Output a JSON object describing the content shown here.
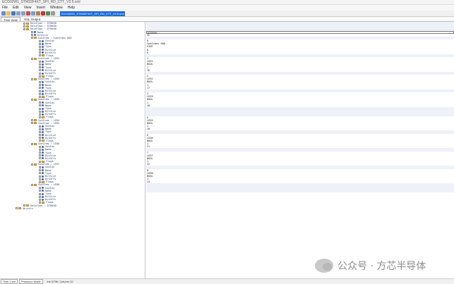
{
  "window": {
    "title": "ECO32W1_STM32F4XT_SPI_RD_CTT_V2.5.xml"
  },
  "menu": [
    "File",
    "Edit",
    "View",
    "Insert",
    "Window",
    "Help"
  ],
  "toolbar": {
    "path_value": "ECO32W1_STM32F4XT_SPI_RD_CTT_V2.5.xml"
  },
  "tabs": [
    {
      "label": "Tree View",
      "active": true
    },
    {
      "label": "XSL Output",
      "active": false
    }
  ],
  "tree_rows": [
    {
      "depth": 3,
      "icon": "folder",
      "text": "DataType : DT0000"
    },
    {
      "depth": 3,
      "icon": "folder",
      "text": "DataType : DT0000"
    },
    {
      "depth": 3,
      "icon": "folder",
      "text": "DataType : DT0000"
    },
    {
      "depth": 4,
      "icon": "dot",
      "text": "Name"
    },
    {
      "depth": 4,
      "icon": "dot",
      "text": "BitSize"
    },
    {
      "depth": 4,
      "icon": "folder",
      "text": "SubItem : SubIndex 000"
    },
    {
      "depth": 5,
      "icon": "dot",
      "text": "SubIdx"
    },
    {
      "depth": 5,
      "icon": "dot",
      "text": "Name"
    },
    {
      "depth": 5,
      "icon": "dot",
      "text": "Type"
    },
    {
      "depth": 5,
      "icon": "dot",
      "text": "BitSize"
    },
    {
      "depth": 5,
      "icon": "dot",
      "text": "BitOffs"
    },
    {
      "depth": 5,
      "icon": "folder",
      "text": "Flags"
    },
    {
      "depth": 4,
      "icon": "folder",
      "text": "SubItem : LED1"
    },
    {
      "depth": 5,
      "icon": "dot",
      "text": "SubIdx"
    },
    {
      "depth": 5,
      "icon": "dot",
      "text": "Name"
    },
    {
      "depth": 5,
      "icon": "dot",
      "text": "Type"
    },
    {
      "depth": 5,
      "icon": "dot",
      "text": "BitSize"
    },
    {
      "depth": 5,
      "icon": "dot",
      "text": "BitOffs"
    },
    {
      "depth": 5,
      "icon": "folder",
      "text": "Flags"
    },
    {
      "depth": 4,
      "icon": "folder",
      "text": "SubItem : LED2"
    },
    {
      "depth": 5,
      "icon": "dot",
      "text": "SubIdx"
    },
    {
      "depth": 5,
      "icon": "dot",
      "text": "Name"
    },
    {
      "depth": 5,
      "icon": "dot",
      "text": "Type"
    },
    {
      "depth": 5,
      "icon": "dot",
      "text": "BitSize"
    },
    {
      "depth": 5,
      "icon": "dot",
      "text": "BitOffs"
    },
    {
      "depth": 5,
      "icon": "folder",
      "text": "Flags"
    },
    {
      "depth": 4,
      "icon": "folder",
      "text": "SubItem : LED3"
    },
    {
      "depth": 5,
      "icon": "dot",
      "text": "SubIdx"
    },
    {
      "depth": 5,
      "icon": "dot",
      "text": "Name"
    },
    {
      "depth": 5,
      "icon": "dot",
      "text": "Type"
    },
    {
      "depth": 5,
      "icon": "dot",
      "text": "BitSize"
    },
    {
      "depth": 5,
      "icon": "dot",
      "text": "BitOffs"
    },
    {
      "depth": 5,
      "icon": "folder",
      "text": "Flags"
    },
    {
      "depth": 4,
      "icon": "folder",
      "text": "SubItem : LED4"
    },
    {
      "depth": 4,
      "icon": "folder",
      "text": "SubItem : LED5"
    },
    {
      "depth": 5,
      "icon": "dot",
      "text": "SubIdx"
    },
    {
      "depth": 5,
      "icon": "dot",
      "text": "Name"
    },
    {
      "depth": 5,
      "icon": "dot",
      "text": "Type"
    },
    {
      "depth": 5,
      "icon": "dot",
      "text": "BitSize"
    },
    {
      "depth": 5,
      "icon": "dot",
      "text": "BitOffs"
    },
    {
      "depth": 5,
      "icon": "folder",
      "text": "Flags"
    },
    {
      "depth": 4,
      "icon": "folder",
      "text": "SubItem : LED6"
    },
    {
      "depth": 5,
      "icon": "dot",
      "text": "SubIdx"
    },
    {
      "depth": 5,
      "icon": "dot",
      "text": "Name"
    },
    {
      "depth": 5,
      "icon": "dot",
      "text": "Type"
    },
    {
      "depth": 5,
      "icon": "dot",
      "text": "BitSize"
    },
    {
      "depth": 5,
      "icon": "dot",
      "text": "BitOffs"
    },
    {
      "depth": 5,
      "icon": "folder",
      "text": "Flags"
    },
    {
      "depth": 4,
      "icon": "folder",
      "text": "SubItem : LED7"
    },
    {
      "depth": 5,
      "icon": "dot",
      "text": "SubIdx"
    },
    {
      "depth": 5,
      "icon": "dot",
      "text": "Name"
    },
    {
      "depth": 5,
      "icon": "dot",
      "text": "Type"
    },
    {
      "depth": 5,
      "icon": "dot",
      "text": "BitSize"
    },
    {
      "depth": 5,
      "icon": "dot",
      "text": "BitOffs"
    },
    {
      "depth": 5,
      "icon": "folder",
      "text": "Flags"
    },
    {
      "depth": 4,
      "icon": "folder",
      "text": "SubItem : LED8"
    },
    {
      "depth": 5,
      "icon": "dot",
      "text": "SubIdx"
    },
    {
      "depth": 5,
      "icon": "dot",
      "text": "Name"
    },
    {
      "depth": 5,
      "icon": "dot",
      "text": "Type"
    },
    {
      "depth": 5,
      "icon": "dot",
      "text": "BitSize"
    },
    {
      "depth": 5,
      "icon": "dot",
      "text": "BitOffs"
    },
    {
      "depth": 5,
      "icon": "folder",
      "text": "Flags"
    },
    {
      "depth": 3,
      "icon": "folder",
      "text": "DataType : DT0000"
    },
    {
      "depth": 2,
      "icon": "folder",
      "text": "Objects"
    }
  ],
  "value_rows": [
    "",
    "",
    "",
    "DT0000",
    "32",
    "",
    "0",
    "SubIndex 000",
    "UINT",
    "8",
    "0",
    "",
    "1",
    "LED1",
    "BOOL",
    "1",
    "16",
    "",
    "2",
    "LED2",
    "BOOL",
    "1",
    "17",
    "",
    "3",
    "LED3",
    "BOOL",
    "1",
    "18",
    "",
    "",
    "",
    "5",
    "LED5",
    "BOOL",
    "1",
    "20",
    "",
    "6",
    "LED6",
    "BOOL",
    "1",
    "21",
    "",
    "7",
    "LED7",
    "BOOL",
    "1",
    "22",
    "",
    "8",
    "LED8",
    "BOOL",
    "1",
    "23",
    "",
    "",
    ""
  ],
  "status": {
    "tabs": [
      "Tree 1 set",
      "Prosecco Mode"
    ],
    "line2": "ine 5798, Column 22"
  },
  "watermark": {
    "text": "公众号 · 方芯半导体"
  },
  "colors": {
    "selection": "#1b6ad6",
    "folder": "#e7b94c",
    "row_shade": "#eef1f8"
  }
}
